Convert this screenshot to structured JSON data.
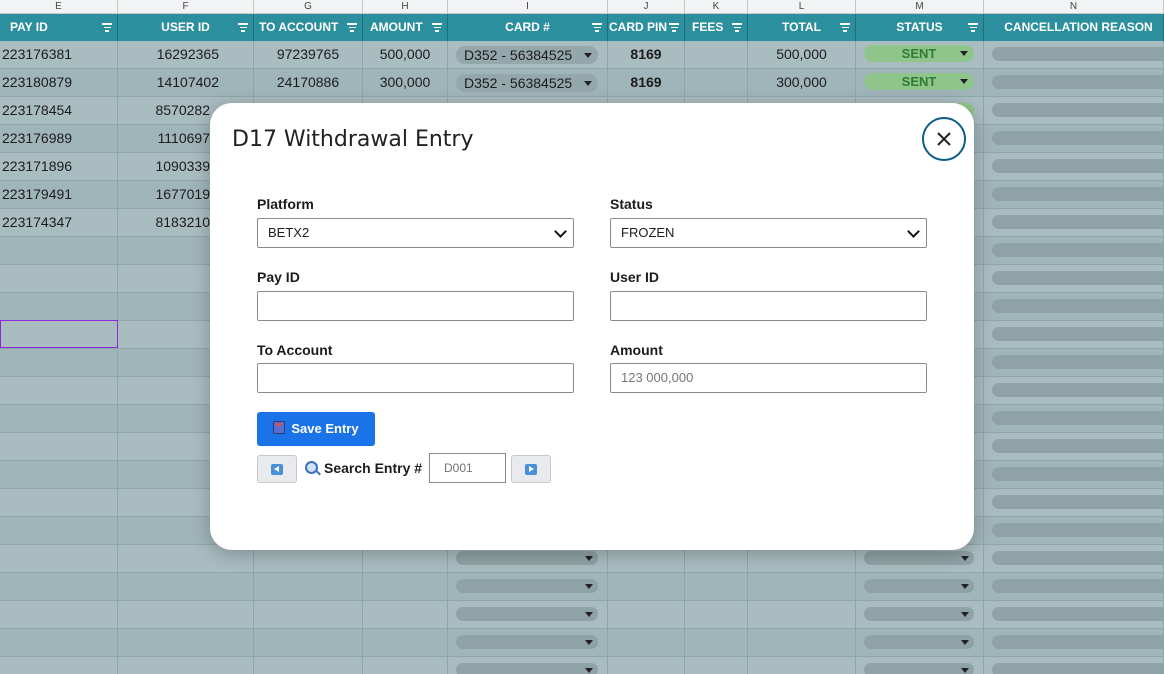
{
  "sheet": {
    "column_letters": [
      "E",
      "F",
      "G",
      "H",
      "I",
      "J",
      "K",
      "L",
      "M",
      "N"
    ],
    "headers": [
      "PAY ID",
      "USER ID",
      "TO ACCOUNT",
      "AMOUNT",
      "CARD #",
      "CARD PIN",
      "FEES",
      "TOTAL",
      "STATUS",
      "CANCELLATION REASON"
    ],
    "rows": [
      {
        "pay_id": "223176381",
        "user_id": "16292365",
        "to_account": "97239765",
        "amount": "500,000",
        "card": "D352 - 56384525",
        "pin": "8169",
        "total": "500,000",
        "status": "SENT"
      },
      {
        "pay_id": "223180879",
        "user_id": "14107402",
        "to_account": "24170886",
        "amount": "300,000",
        "card": "D352 - 56384525",
        "pin": "8169",
        "total": "300,000",
        "status": "SENT"
      },
      {
        "pay_id": "223178454",
        "user_id": "8570282"
      },
      {
        "pay_id": "223176989",
        "user_id": "1110697"
      },
      {
        "pay_id": "223171896",
        "user_id": "1090339"
      },
      {
        "pay_id": "223179491",
        "user_id": "1677019"
      },
      {
        "pay_id": "223174347",
        "user_id": "8183210"
      }
    ]
  },
  "modal": {
    "title": "D17 Withdrawal Entry",
    "close_icon": "close-x-icon",
    "platform_label": "Platform",
    "platform_value": "BETX2",
    "status_label": "Status",
    "status_value": "FROZEN",
    "pay_id_label": "Pay ID",
    "pay_id_value": "",
    "user_id_label": "User ID",
    "user_id_value": "",
    "to_account_label": "To Account",
    "to_account_value": "",
    "amount_label": "Amount",
    "amount_placeholder": "123 000,000",
    "save_label": "Save Entry",
    "search_label": "Search Entry #",
    "search_placeholder": "D001"
  },
  "colors": {
    "header_teal": "#2c8f9e",
    "save_blue": "#1a73e8",
    "close_ring": "#0b5e87",
    "status_sent_green": "#8fc48a"
  }
}
